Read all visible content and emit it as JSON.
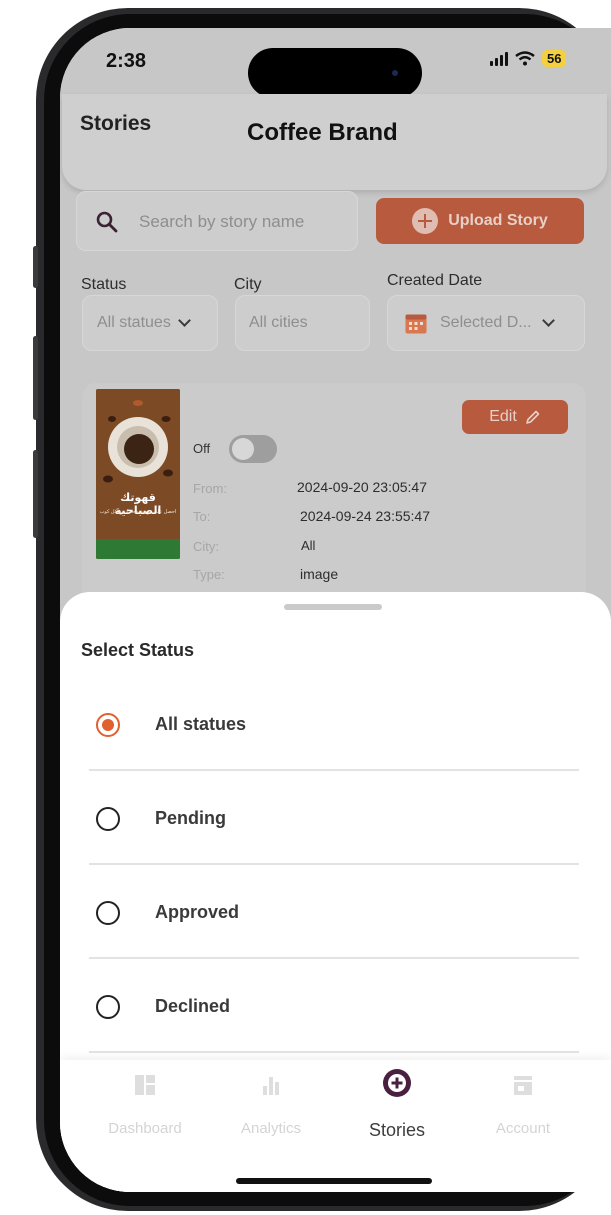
{
  "status_bar": {
    "time": "2:38",
    "battery": "56"
  },
  "header": {
    "title": "Stories",
    "brand": "Coffee Brand"
  },
  "search": {
    "placeholder": "Search by story name"
  },
  "upload_button": {
    "label": "Upload Story"
  },
  "filters": {
    "status": {
      "label": "Status",
      "value": "All statues"
    },
    "city": {
      "label": "City",
      "value": "All cities"
    },
    "created_date": {
      "label": "Created Date",
      "value": "Selected D..."
    }
  },
  "story": {
    "thumbnail_title": "قهوتك الصباحية",
    "thumbnail_subtitle": "احصل على دوسة مجانية مع كل كوب",
    "edit_label": "Edit",
    "toggle_label": "Off",
    "toggle_on": false,
    "fields": {
      "from_label": "From:",
      "from_value": "2024-09-20 23:05:47",
      "to_label": "To:",
      "to_value": "2024-09-24 23:55:47",
      "city_label": "City:",
      "city_value": "All",
      "type_label": "Type:",
      "type_value": "image"
    }
  },
  "status_sheet": {
    "title": "Select Status",
    "options": [
      {
        "label": "All statues",
        "selected": true
      },
      {
        "label": "Pending",
        "selected": false
      },
      {
        "label": "Approved",
        "selected": false
      },
      {
        "label": "Declined",
        "selected": false
      }
    ]
  },
  "nav": {
    "items": [
      {
        "label": "Dashboard",
        "icon": "dashboard-icon",
        "active": false
      },
      {
        "label": "Analytics",
        "icon": "analytics-icon",
        "active": false
      },
      {
        "label": "Stories",
        "icon": "add-circle-icon",
        "active": true
      },
      {
        "label": "Account",
        "icon": "store-icon",
        "active": false
      }
    ]
  },
  "colors": {
    "accent": "#e0602e",
    "button_dimmed": "#b85a3e",
    "active_nav": "#4a2040",
    "overlay": "#c7c7c7"
  }
}
